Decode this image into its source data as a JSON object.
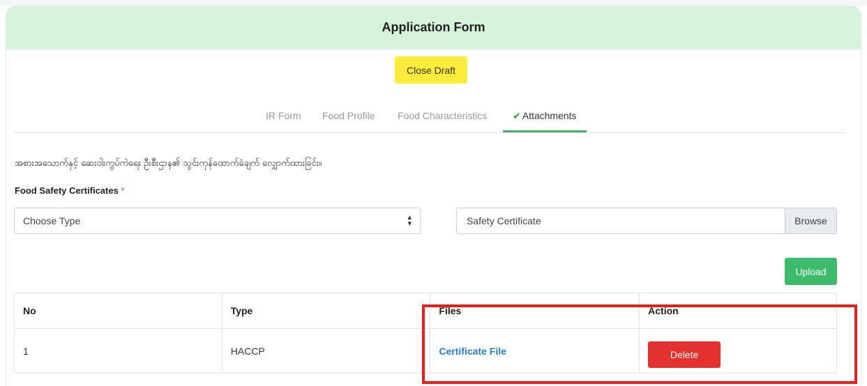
{
  "form": {
    "title": "Application Form",
    "close_draft_label": "Close Draft"
  },
  "tabs": [
    {
      "label": "IR Form",
      "active": false
    },
    {
      "label": "Food Profile",
      "active": false
    },
    {
      "label": "Food Characteristics",
      "active": false
    },
    {
      "label": "Attachments",
      "active": true,
      "icon": "check-icon"
    }
  ],
  "attachments": {
    "intro_text": "အစားအသောက်နှင့် ဆေးဝါးကွပ်ကဲရေး ဦးစီးဌာန၏ သွင်းကုန်ထောက်ခံချက် လျှောက်ထားခြင်း။",
    "section_label": "Food Safety Certificates",
    "required_mark": "*",
    "type_select": {
      "value": "Choose Type",
      "icon": "sort-arrows-icon"
    },
    "file_input": {
      "value": "Safety Certificate",
      "browse_label": "Browse"
    },
    "upload_label": "Upload"
  },
  "table": {
    "headers": [
      "No",
      "Type",
      "Files",
      "Action"
    ],
    "rows": [
      {
        "no": "1",
        "type": "HACCP",
        "file": "Certificate File",
        "action": "Delete"
      }
    ]
  },
  "colors": {
    "header_bg": "#d4f3d8",
    "close_draft_bg": "#ffeb3b",
    "upload_bg": "#3dbb6a",
    "delete_bg": "#e2312e",
    "link": "#2b7bbf",
    "active_tab_border": "#4cae6b",
    "highlight": "#ee1c1c"
  }
}
